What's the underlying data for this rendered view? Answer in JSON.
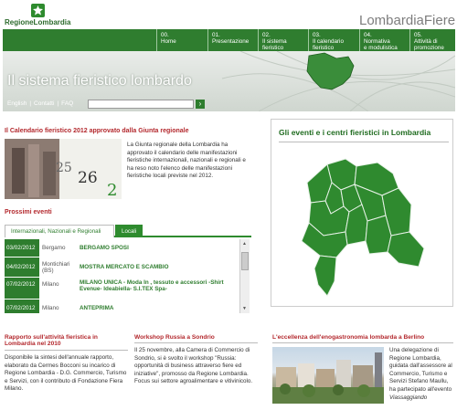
{
  "header": {
    "logo_text": "RegioneLombardia",
    "brand": "LombardiaFiere"
  },
  "nav": [
    {
      "num": "00.",
      "label": "Home"
    },
    {
      "num": "01.",
      "label": "Presentazione"
    },
    {
      "num": "02.",
      "label": "Il sistema",
      "label2": "fieristico"
    },
    {
      "num": "03.",
      "label": "Il calendario",
      "label2": "fieristico"
    },
    {
      "num": "04.",
      "label": "Normativa",
      "label2": "e modulistica"
    },
    {
      "num": "05.",
      "label": "Attività di",
      "label2": "promozione"
    }
  ],
  "hero": {
    "title": "Il sistema fieristico lombardo",
    "links": [
      "English",
      "|",
      "Contatti",
      "|",
      "FAQ"
    ],
    "search_placeholder": "",
    "search_button": "›"
  },
  "calendar": {
    "title": "Il Calendario fieristico 2012 approvato dalla Giunta regionale",
    "text": "La Giunta regionale della Lombardia ha approvato il calendario delle manifestazioni fieristiche internazionali, nazionali e regionali e ha reso noto l'elenco delle manifestazioni fieristiche locali previste nel 2012."
  },
  "events": {
    "title": "Prossimi eventi",
    "tabs": [
      "Internazionali, Nazionali e Regionali",
      "Locali"
    ],
    "rows": [
      {
        "date": "03/02/2012",
        "place": "Bergamo",
        "name": "BERGAMO SPOSI"
      },
      {
        "date": "04/02/2012",
        "place": "Montichiari (BS)",
        "name": "MOSTRA MERCATO E SCAMBIO"
      },
      {
        "date": "07/02/2012",
        "place": "Milano",
        "name": "MILANO UNICA - Moda In , tessuto e accessori -Shirt Evenue- Ideabiella- S.I.TEX Spa-"
      },
      {
        "date": "07/02/2012",
        "place": "Milano",
        "name": "ANTEPRIMA"
      }
    ]
  },
  "map": {
    "title": "Gli eventi e i centri fieristici in Lombardia"
  },
  "bottom": {
    "b1_title": "Rapporto sull'attività fieristica in Lombardia nel 2010",
    "b1_text": "Disponibile la sintesi dell'annuale rapporto, elaborato da Cermes Bocconi su incarico di Regione Lombardia - D.G. Commercio, Turismo e Servizi, con il contributo di Fondazione Fiera Milano.",
    "b2_title": "Workshop Russia a Sondrio",
    "b2_text": "Il 25 novembre, alla Camera di Commercio di Sondrio, si è svolto il workshop \"Russia: opportunità di business attraverso fiere ed iniziative\", promosso da Regione Lombardia. Focus sui settore agroalimentare e vitivinicolo.",
    "b3_title": "L'eccellenza dell'enogastronomia lombarda a Berlino",
    "b3_text": "Una delegazione di Regione Lombardia, guidata dall'assessore al Commercio, Turismo e Servizi Stefano Maullu, ha partecipato all'evento",
    "b3_italic": "Viassaggiando"
  },
  "colors": {
    "green": "#2f7d2f",
    "red": "#b3282d"
  }
}
